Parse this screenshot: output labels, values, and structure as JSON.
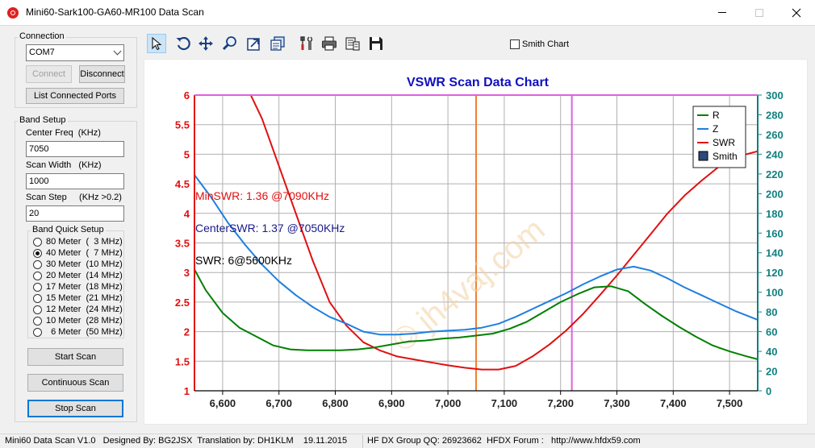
{
  "window": {
    "title": "Mini60-Sark100-GA60-MR100 Data Scan"
  },
  "connection": {
    "group_label": "Connection",
    "port": "COM7",
    "connect_label": "Connect",
    "disconnect_label": "Disconnect",
    "list_ports_label": "List Connected Ports"
  },
  "band_setup": {
    "group_label": "Band Setup",
    "center_freq_label": "Center Freq  (KHz)",
    "center_freq_value": "7050",
    "scan_width_label": "Scan Width   (KHz)",
    "scan_width_value": "1000",
    "scan_step_label": "Scan Step     (KHz >0.2)",
    "scan_step_value": "20",
    "quick_setup_label": "Band Quick Setup",
    "bands": [
      {
        "label": "80 Meter  (  3 MHz)",
        "checked": false
      },
      {
        "label": "40 Meter  (  7 MHz)",
        "checked": true
      },
      {
        "label": "30 Meter  (10 MHz)",
        "checked": false
      },
      {
        "label": "20 Meter  (14 MHz)",
        "checked": false
      },
      {
        "label": "17 Meter  (18 MHz)",
        "checked": false
      },
      {
        "label": "15 Meter  (21 MHz)",
        "checked": false
      },
      {
        "label": "12 Meter  (24 MHz)",
        "checked": false
      },
      {
        "label": "10 Meter  (28 MHz)",
        "checked": false
      },
      {
        "label": "  6 Meter  (50 MHz)",
        "checked": false
      }
    ]
  },
  "actions": {
    "start_scan_label": "Start Scan",
    "continuous_scan_label": "Continuous Scan",
    "stop_scan_label": "Stop Scan"
  },
  "toolbar": {
    "tools": [
      "pointer-icon",
      "rotate-icon",
      "move-icon",
      "zoom-icon",
      "export-icon",
      "copy-icon",
      "tools-icon",
      "print-icon",
      "data-icon",
      "save-icon"
    ],
    "smith_chart_label": "Smith Chart",
    "smith_chart_checked": false
  },
  "status": {
    "left": "Mini60 Data Scan V1.0   Designed By: BG2JSX  Translation by: DH1KLM    19.11.2015",
    "right": "HF DX Group QQ: 26923662  HFDX Forum :   http://www.hfdx59.com"
  },
  "chart_data": {
    "type": "line",
    "title": "VSWR Scan Data Chart",
    "xlim": [
      6550,
      7550
    ],
    "x_ticks": [
      "6,600",
      "6,700",
      "6,800",
      "6,900",
      "7,000",
      "7,100",
      "7,200",
      "7,300",
      "7,400",
      "7,500"
    ],
    "x_tick_values": [
      6600,
      6700,
      6800,
      6900,
      7000,
      7100,
      7200,
      7300,
      7400,
      7500
    ],
    "ylim_left": [
      1,
      6
    ],
    "y_ticks_left": [
      "1",
      "1.5",
      "2",
      "2.5",
      "3",
      "3.5",
      "4",
      "4.5",
      "5",
      "5.5",
      "6"
    ],
    "ylim_right": [
      0,
      300
    ],
    "y_ticks_right": [
      "0",
      "20",
      "40",
      "60",
      "80",
      "100",
      "120",
      "140",
      "160",
      "180",
      "200",
      "220",
      "240",
      "260",
      "280",
      "300"
    ],
    "grid": true,
    "legend_position": "top-right",
    "legend": [
      {
        "name": "R",
        "color": "#008000"
      },
      {
        "name": "Z",
        "color": "#1e7fe0"
      },
      {
        "name": "SWR",
        "color": "#e01010"
      },
      {
        "name": "Smith",
        "color": "#2a4a7a"
      }
    ],
    "annotations": {
      "min_swr": "MinSWR: 1.36 @7090KHz",
      "center_swr": "CenterSWR: 1.37 @7050KHz",
      "swr_at": "SWR: 6@5600KHz"
    },
    "watermark": "© jh4vaj.com",
    "markers": [
      {
        "x": 7050,
        "color": "#f08030"
      },
      {
        "x": 7220,
        "color": "#e060e0"
      },
      {
        "x": 6550,
        "color": "#e01010"
      }
    ],
    "series": [
      {
        "name": "SWR",
        "axis": "left",
        "color": "#e01010",
        "x": [
          6650,
          6670,
          6700,
          6730,
          6760,
          6790,
          6820,
          6850,
          6880,
          6910,
          6940,
          6970,
          7000,
          7030,
          7060,
          7090,
          7120,
          7150,
          7180,
          7210,
          7240,
          7270,
          7300,
          7330,
          7360,
          7390,
          7420,
          7450,
          7480,
          7510,
          7550
        ],
        "y": [
          6.0,
          5.6,
          4.8,
          4.0,
          3.2,
          2.5,
          2.1,
          1.82,
          1.68,
          1.58,
          1.53,
          1.48,
          1.43,
          1.39,
          1.36,
          1.36,
          1.42,
          1.58,
          1.78,
          2.02,
          2.3,
          2.62,
          2.95,
          3.3,
          3.65,
          4.0,
          4.3,
          4.55,
          4.78,
          4.95,
          5.05
        ]
      },
      {
        "name": "Z",
        "axis": "right",
        "color": "#1e7fe0",
        "x": [
          6550,
          6580,
          6610,
          6640,
          6670,
          6700,
          6730,
          6760,
          6790,
          6820,
          6850,
          6880,
          6910,
          6940,
          6970,
          7000,
          7030,
          7060,
          7090,
          7120,
          7150,
          7180,
          7210,
          7240,
          7270,
          7300,
          7330,
          7360,
          7390,
          7420,
          7450,
          7480,
          7510,
          7550
        ],
        "y": [
          219,
          196,
          170,
          148,
          128,
          111,
          97,
          85,
          75,
          68,
          60,
          57,
          57,
          58,
          60,
          61,
          62,
          64,
          68,
          75,
          83,
          91,
          99,
          108,
          116,
          123,
          126,
          122,
          114,
          105,
          97,
          89,
          81,
          72
        ]
      },
      {
        "name": "R",
        "axis": "right",
        "color": "#008000",
        "x": [
          6550,
          6570,
          6600,
          6630,
          6660,
          6690,
          6720,
          6750,
          6780,
          6810,
          6840,
          6870,
          6900,
          6930,
          6960,
          6990,
          7020,
          7050,
          7080,
          7110,
          7140,
          7170,
          7200,
          7230,
          7260,
          7290,
          7320,
          7350,
          7380,
          7410,
          7440,
          7470,
          7500,
          7530,
          7550
        ],
        "y": [
          123,
          102,
          79,
          64,
          55,
          46,
          42,
          41,
          41,
          41,
          42,
          44,
          47,
          50,
          51,
          53,
          54,
          56,
          58,
          63,
          70,
          80,
          90,
          98,
          105,
          106,
          101,
          88,
          76,
          65,
          55,
          46,
          40,
          35,
          32
        ]
      }
    ]
  }
}
